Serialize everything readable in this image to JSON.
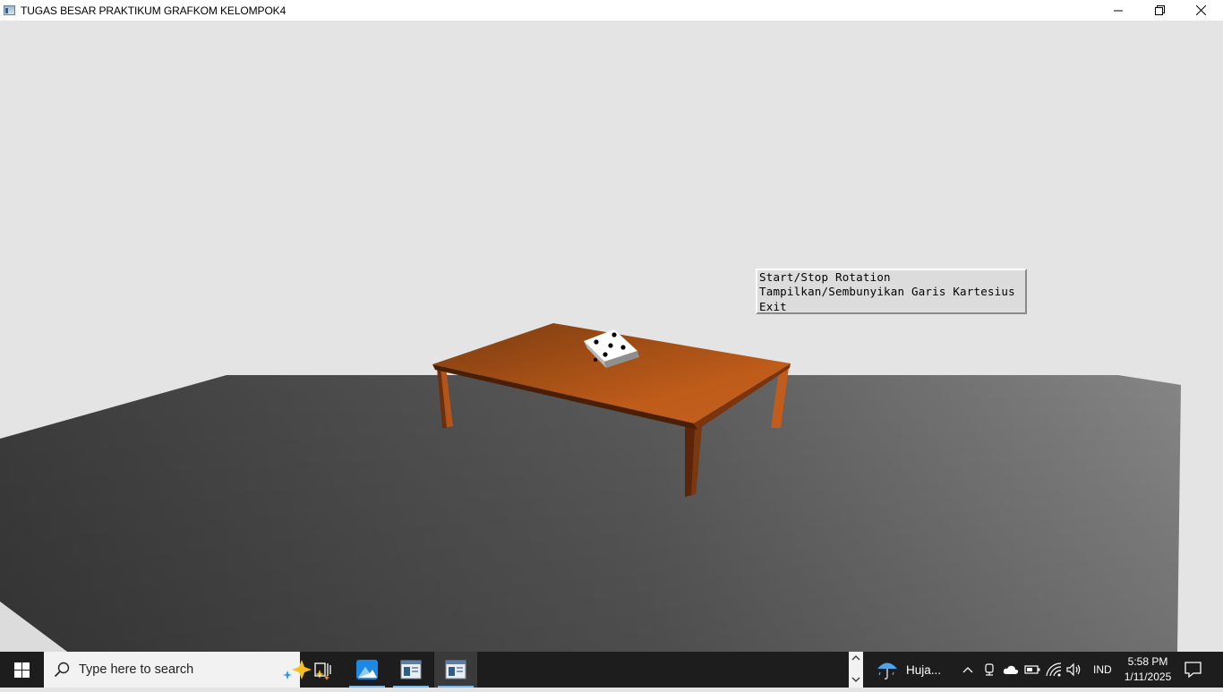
{
  "window": {
    "title": "TUGAS BESAR PRAKTIKUM GRAFKOM KELOMPOK4",
    "controls": [
      "minimize-icon",
      "restore-icon",
      "close-icon"
    ]
  },
  "scene": {
    "background_color": "#e4e4e4",
    "floor_color": "#5a5a5a",
    "table_color": "#b4561a",
    "dice_color": "#ffffff"
  },
  "context_menu": {
    "items": [
      "Start/Stop Rotation",
      "Tampilkan/Sembunyikan Garis Kartesius",
      "Exit"
    ]
  },
  "taskbar": {
    "search_placeholder": "Type here to search",
    "weather_text": "Huja...",
    "language": "IND",
    "time": "5:58 PM",
    "date": "1/11/2025"
  }
}
